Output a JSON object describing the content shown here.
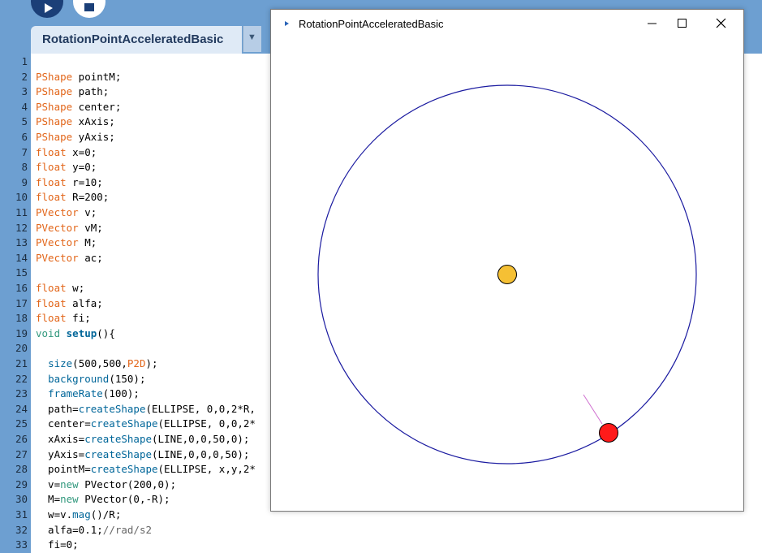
{
  "toolbar": {
    "run_icon": "play-icon",
    "stop_icon": "stop-icon"
  },
  "tab": {
    "label": "RotationPointAcceleratedBasic",
    "menu_icon": "chevron-down-icon"
  },
  "editor": {
    "line_numbers": [
      "1",
      "2",
      "3",
      "4",
      "5",
      "6",
      "7",
      "8",
      "9",
      "10",
      "11",
      "12",
      "13",
      "14",
      "15",
      "16",
      "17",
      "18",
      "19",
      "20",
      "21",
      "22",
      "23",
      "24",
      "25",
      "26",
      "27",
      "28",
      "29",
      "30",
      "31",
      "32",
      "33"
    ],
    "lines": [
      [],
      [
        {
          "t": "PShape",
          "c": "type"
        },
        {
          "t": " pointM;",
          "c": ""
        }
      ],
      [
        {
          "t": "PShape",
          "c": "type"
        },
        {
          "t": " path;",
          "c": ""
        }
      ],
      [
        {
          "t": "PShape",
          "c": "type"
        },
        {
          "t": " center;",
          "c": ""
        }
      ],
      [
        {
          "t": "PShape",
          "c": "type"
        },
        {
          "t": " xAxis;",
          "c": ""
        }
      ],
      [
        {
          "t": "PShape",
          "c": "type"
        },
        {
          "t": " yAxis;",
          "c": ""
        }
      ],
      [
        {
          "t": "float",
          "c": "type"
        },
        {
          "t": " x=0;",
          "c": ""
        }
      ],
      [
        {
          "t": "float",
          "c": "type"
        },
        {
          "t": " y=0;",
          "c": ""
        }
      ],
      [
        {
          "t": "float",
          "c": "type"
        },
        {
          "t": " r=10;",
          "c": ""
        }
      ],
      [
        {
          "t": "float",
          "c": "type"
        },
        {
          "t": " R=200;",
          "c": ""
        }
      ],
      [
        {
          "t": "PVector",
          "c": "type"
        },
        {
          "t": " v;",
          "c": ""
        }
      ],
      [
        {
          "t": "PVector",
          "c": "type"
        },
        {
          "t": " vM;",
          "c": ""
        }
      ],
      [
        {
          "t": "PVector",
          "c": "type"
        },
        {
          "t": " M;",
          "c": ""
        }
      ],
      [
        {
          "t": "PVector",
          "c": "type"
        },
        {
          "t": " ac;",
          "c": ""
        }
      ],
      [],
      [
        {
          "t": "float",
          "c": "type"
        },
        {
          "t": " w;",
          "c": ""
        }
      ],
      [
        {
          "t": "float",
          "c": "type"
        },
        {
          "t": " alfa;",
          "c": ""
        }
      ],
      [
        {
          "t": "float",
          "c": "type"
        },
        {
          "t": " fi;",
          "c": ""
        }
      ],
      [
        {
          "t": "void",
          "c": "kw"
        },
        {
          "t": " ",
          "c": ""
        },
        {
          "t": "setup",
          "c": "bold"
        },
        {
          "t": "(){",
          "c": ""
        }
      ],
      [],
      [
        {
          "t": "  ",
          "c": ""
        },
        {
          "t": "size",
          "c": "func"
        },
        {
          "t": "(500,500,",
          "c": ""
        },
        {
          "t": "P2D",
          "c": "type"
        },
        {
          "t": ");",
          "c": ""
        }
      ],
      [
        {
          "t": "  ",
          "c": ""
        },
        {
          "t": "background",
          "c": "func"
        },
        {
          "t": "(150);",
          "c": ""
        }
      ],
      [
        {
          "t": "  ",
          "c": ""
        },
        {
          "t": "frameRate",
          "c": "func"
        },
        {
          "t": "(100);",
          "c": ""
        }
      ],
      [
        {
          "t": "  path=",
          "c": ""
        },
        {
          "t": "createShape",
          "c": "func"
        },
        {
          "t": "(ELLIPSE, 0,0,2*R,",
          "c": ""
        }
      ],
      [
        {
          "t": "  center=",
          "c": ""
        },
        {
          "t": "createShape",
          "c": "func"
        },
        {
          "t": "(ELLIPSE, 0,0,2*",
          "c": ""
        }
      ],
      [
        {
          "t": "  xAxis=",
          "c": ""
        },
        {
          "t": "createShape",
          "c": "func"
        },
        {
          "t": "(LINE,0,0,50,0);",
          "c": ""
        }
      ],
      [
        {
          "t": "  yAxis=",
          "c": ""
        },
        {
          "t": "createShape",
          "c": "func"
        },
        {
          "t": "(LINE,0,0,0,50);",
          "c": ""
        }
      ],
      [
        {
          "t": "  pointM=",
          "c": ""
        },
        {
          "t": "createShape",
          "c": "func"
        },
        {
          "t": "(ELLIPSE, x,y,2*",
          "c": ""
        }
      ],
      [
        {
          "t": "  v=",
          "c": ""
        },
        {
          "t": "new",
          "c": "kw"
        },
        {
          "t": " PVector(200,0);",
          "c": ""
        }
      ],
      [
        {
          "t": "  M=",
          "c": ""
        },
        {
          "t": "new",
          "c": "kw"
        },
        {
          "t": " PVector(0,-R);",
          "c": ""
        }
      ],
      [
        {
          "t": "  w=v.",
          "c": ""
        },
        {
          "t": "mag",
          "c": "func"
        },
        {
          "t": "()/R;",
          "c": ""
        }
      ],
      [
        {
          "t": "  alfa=0.1;",
          "c": ""
        },
        {
          "t": "//rad/s2",
          "c": "comment"
        }
      ],
      [
        {
          "t": "  fi=0;",
          "c": ""
        }
      ]
    ]
  },
  "sketch_window": {
    "title": "RotationPointAcceleratedBasic",
    "app_icon": "processing-arrow-icon",
    "minimize_icon": "minimize-icon",
    "maximize_icon": "maximize-icon",
    "close_icon": "close-icon",
    "colors": {
      "path_stroke": "#1a1aa0",
      "center_fill": "#f5c034",
      "point_fill": "#ff1a1a",
      "vector_stroke": "#d070d0"
    }
  }
}
